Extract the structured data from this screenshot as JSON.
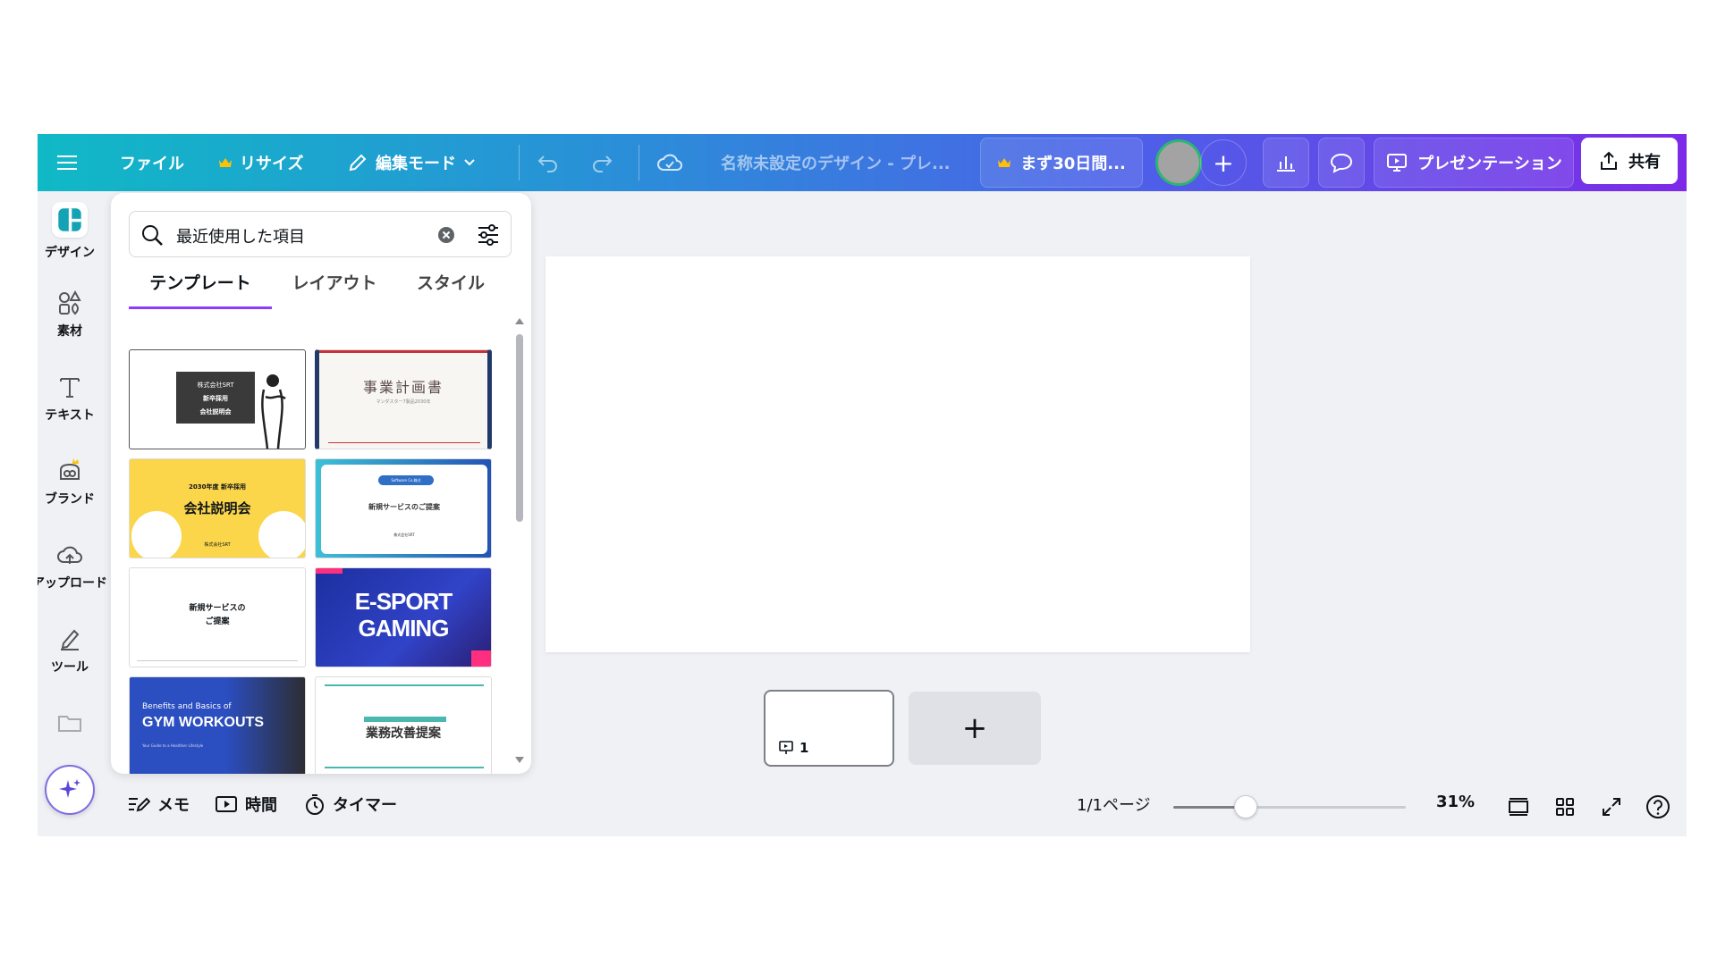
{
  "topbar": {
    "file_label": "ファイル",
    "resize_label": "リサイズ",
    "edit_mode_label": "編集モード",
    "doc_title": "名称未設定のデザイン - プレ...",
    "trial_label": "まず30日間...",
    "present_label": "プレゼンテーション",
    "share_label": "共有"
  },
  "rail": {
    "items": [
      {
        "label": "デザイン",
        "icon": "design-icon"
      },
      {
        "label": "素材",
        "icon": "elements-icon"
      },
      {
        "label": "テキスト",
        "icon": "text-icon"
      },
      {
        "label": "ブランド",
        "icon": "brand-icon"
      },
      {
        "label": "アップロード",
        "icon": "upload-cloud-icon"
      },
      {
        "label": "ツール",
        "icon": "tools-icon"
      }
    ]
  },
  "panel": {
    "search_value": "最近使用した項目",
    "tabs": [
      "テンプレート",
      "レイアウト",
      "スタイル"
    ],
    "active_tab": 0,
    "templates": [
      {
        "id": "t1",
        "lines": [
          "株式会社SRT",
          "新卒採用",
          "会社説明会"
        ]
      },
      {
        "id": "t2",
        "lines": [
          "事業計画書",
          "マンダスター7製品2030年"
        ]
      },
      {
        "id": "t3",
        "lines": [
          "2030年度 新卒採用",
          "会社説明会",
          "株式会社SRT"
        ]
      },
      {
        "id": "t4",
        "lines": [
          "Software Co.株式",
          "新規サービスのご提案",
          "株式会社SRT"
        ]
      },
      {
        "id": "t5",
        "lines": [
          "新規サービスの",
          "ご提案"
        ]
      },
      {
        "id": "t6",
        "lines": [
          "E-SPORT",
          "GAMING"
        ]
      },
      {
        "id": "t7",
        "lines": [
          "Benefits and Basics of",
          "GYM WORKOUTS",
          "Your Guide to a Healthier Lifestyle"
        ]
      },
      {
        "id": "t8",
        "lines": [
          "業務改善提案"
        ]
      }
    ]
  },
  "canvas": {
    "page_number": "1",
    "add_page": "+"
  },
  "bottombar": {
    "memo_label": "メモ",
    "time_label": "時間",
    "timer_label": "タイマー",
    "page_indicator": "1/1ページ",
    "zoom_percent": "31%",
    "zoom_level": 0.31
  },
  "colors": {
    "accent": "#8b3dff",
    "topbar_start": "#10b9c6",
    "topbar_end": "#7d2ae8",
    "crown": "#ffc107"
  }
}
